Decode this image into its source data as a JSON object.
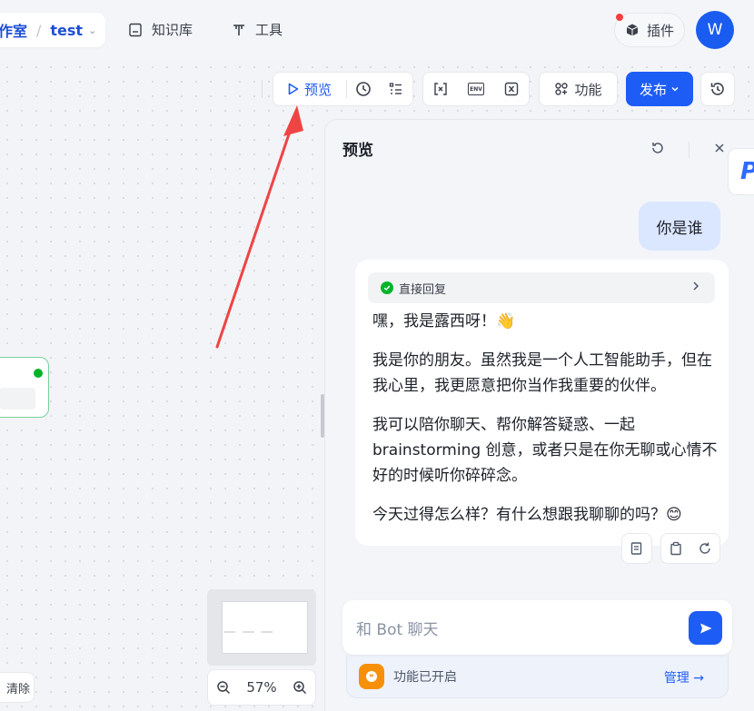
{
  "breadcrumb": {
    "workspace": "作室",
    "project": "test"
  },
  "nav": [
    {
      "label": "知识库"
    },
    {
      "label": "工具"
    }
  ],
  "plugin": {
    "label": "插件"
  },
  "avatar": {
    "initial": "W"
  },
  "toolbar": {
    "preview_label": "预览",
    "function_label": "功能",
    "publish_label": "发布",
    "env_label": "ENV"
  },
  "preview_panel": {
    "title": "预览",
    "user_message": "你是谁",
    "tool_call": {
      "label": "直接回复"
    },
    "bot_paragraphs": [
      "嘿，我是露西呀！👋",
      "我是你的朋友。虽然我是一个人工智能助手，但在我心里，我更愿意把你当作我重要的伙伴。",
      "我可以陪你聊天、帮你解答疑惑、一起 brainstorming 创意，或者只是在你无聊或心情不好的时候听你碎碎念。",
      "今天过得怎么样？有什么想跟我聊聊的吗？😊"
    ],
    "input_placeholder": "和 Bot 聊天",
    "feature_status": "功能已开启",
    "manage_label": "管理 →"
  },
  "canvas": {
    "zoom_value": "57%",
    "clear_label": "清除",
    "side_tab_letter": "P"
  },
  "colors": {
    "accent": "#1d5cf5",
    "success": "#00b42a",
    "annotation_arrow": "#ef4444"
  }
}
